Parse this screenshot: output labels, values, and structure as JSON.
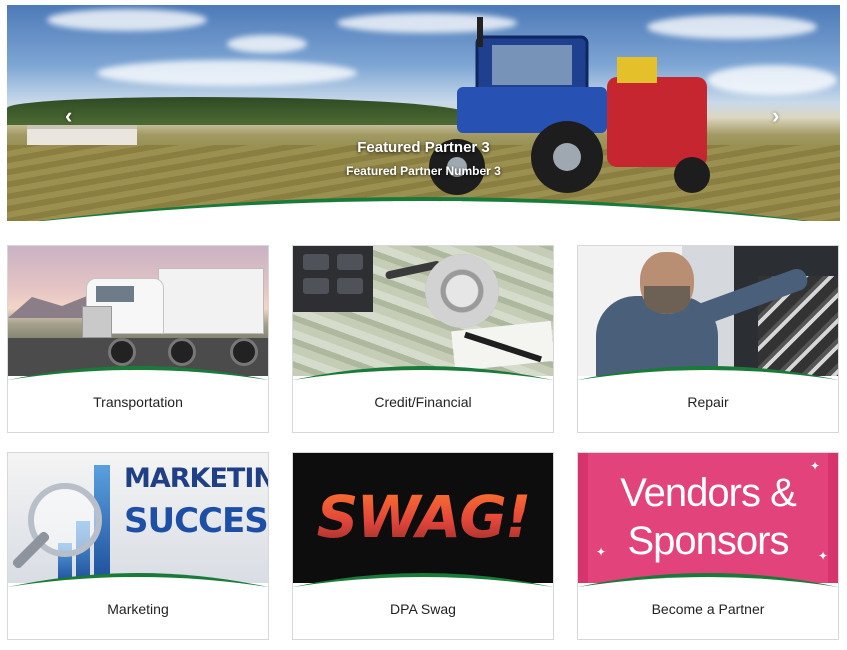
{
  "carousel": {
    "title": "Featured Partner 3",
    "subtitle": "Featured Partner Number 3",
    "prev_icon": "chevron-left-icon",
    "next_icon": "chevron-right-icon",
    "slide_count": 3,
    "active_slide": 2
  },
  "categories": [
    {
      "label": "Transportation"
    },
    {
      "label": "Credit/Financial"
    },
    {
      "label": "Repair"
    },
    {
      "label": "Marketing",
      "image_text": [
        "MARKETING",
        "SUCCESS"
      ]
    },
    {
      "label": "DPA Swag",
      "image_text": [
        "SWAG!"
      ]
    },
    {
      "label": "Become a Partner",
      "image_text": [
        "Vendors &",
        "Sponsors"
      ]
    }
  ],
  "colors": {
    "swoosh_green": "#1a7a3a",
    "card_border": "#d8d8d8",
    "label_text": "#222222"
  }
}
